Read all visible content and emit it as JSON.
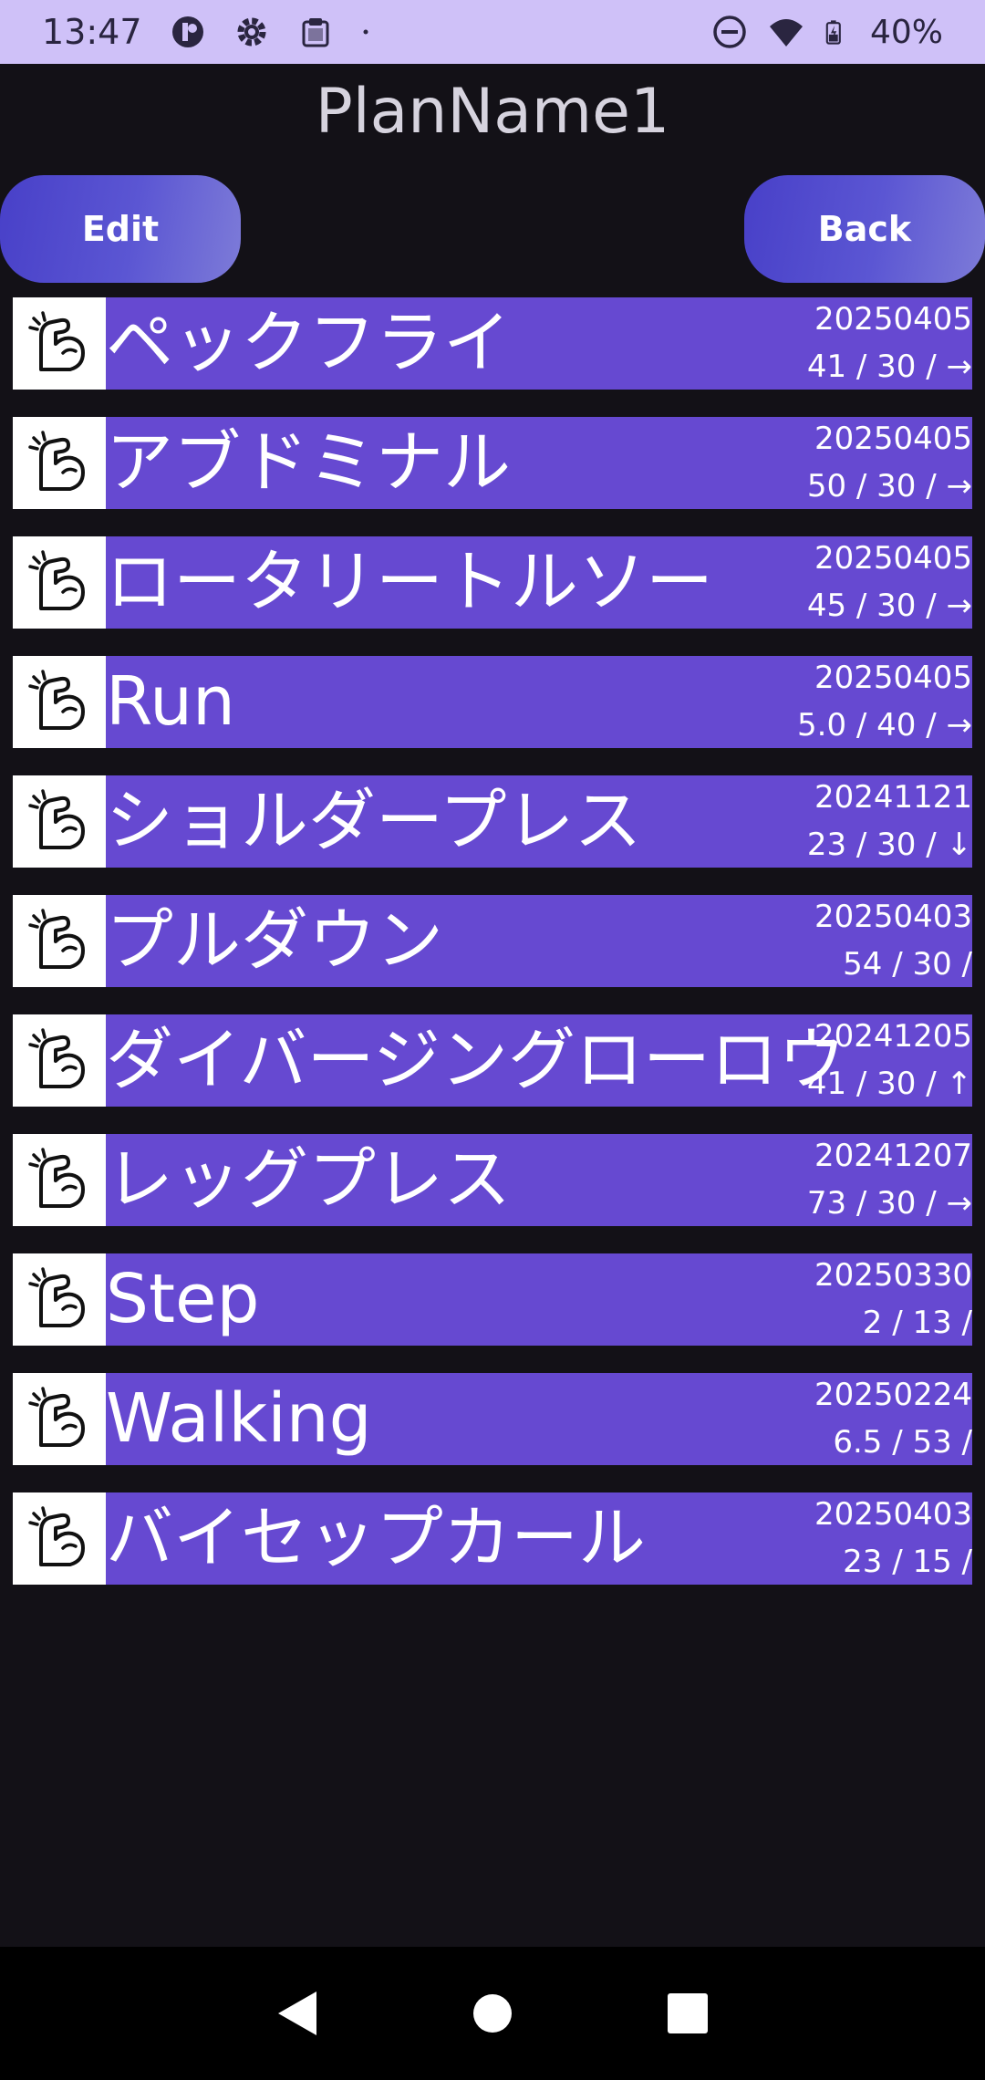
{
  "status_bar": {
    "time": "13:47",
    "battery": "40%",
    "icons": [
      "app-icon",
      "gear-icon",
      "clipboard-icon",
      "dot-icon",
      "dnd-icon",
      "wifi-icon",
      "battery-icon"
    ]
  },
  "title": "PlanName1",
  "buttons": {
    "edit": "Edit",
    "back": "Back"
  },
  "items": [
    {
      "name": "ペックフライ",
      "date": "20250405",
      "stats": "41 / 30 / →"
    },
    {
      "name": "アブドミナル",
      "date": "20250405",
      "stats": "50 / 30 / →"
    },
    {
      "name": "ロータリートルソー",
      "date": "20250405",
      "stats": "45 / 30 / →"
    },
    {
      "name": "Run",
      "date": "20250405",
      "stats": "5.0 / 40 / →"
    },
    {
      "name": "ショルダープレス",
      "date": "20241121",
      "stats": "23 / 30 / ↓"
    },
    {
      "name": "プルダウン",
      "date": "20250403",
      "stats": "54 / 30 /"
    },
    {
      "name": "ダイバージングローロウ",
      "date": "20241205",
      "stats": "41 / 30 / ↑"
    },
    {
      "name": "レッグプレス",
      "date": "20241207",
      "stats": "73 / 30 / →"
    },
    {
      "name": "Step",
      "date": "20250330",
      "stats": "2 / 13 /"
    },
    {
      "name": "Walking",
      "date": "20250224",
      "stats": "6.5 / 53 /"
    },
    {
      "name": "バイセップカール",
      "date": "20250403",
      "stats": "23 / 15 /"
    }
  ],
  "colors": {
    "status_bar": "#cfc1f8",
    "background": "#131117",
    "row_bar": "#6649d1",
    "button_start": "#4840c8",
    "button_end": "#7d7bd8"
  }
}
